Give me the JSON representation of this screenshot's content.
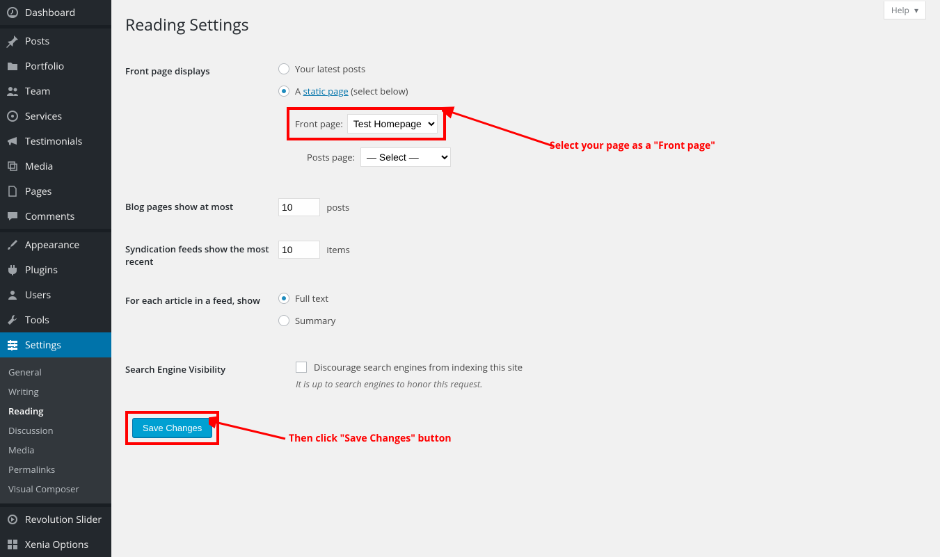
{
  "sidebar": {
    "items": [
      {
        "label": "Dashboard"
      },
      {
        "label": "Posts"
      },
      {
        "label": "Portfolio"
      },
      {
        "label": "Team"
      },
      {
        "label": "Services"
      },
      {
        "label": "Testimonials"
      },
      {
        "label": "Media"
      },
      {
        "label": "Pages"
      },
      {
        "label": "Comments"
      },
      {
        "label": "Appearance"
      },
      {
        "label": "Plugins"
      },
      {
        "label": "Users"
      },
      {
        "label": "Tools"
      },
      {
        "label": "Settings"
      }
    ],
    "submenu": [
      {
        "label": "General"
      },
      {
        "label": "Writing"
      },
      {
        "label": "Reading"
      },
      {
        "label": "Discussion"
      },
      {
        "label": "Media"
      },
      {
        "label": "Permalinks"
      },
      {
        "label": "Visual Composer"
      }
    ],
    "tail": [
      {
        "label": "Revolution Slider"
      },
      {
        "label": "Xenia Options"
      }
    ]
  },
  "help": {
    "label": "Help"
  },
  "page": {
    "title": "Reading Settings"
  },
  "front": {
    "heading": "Front page displays",
    "opt_latest": "Your latest posts",
    "opt_static_prefix": "A ",
    "opt_static_link": "static page",
    "opt_static_suffix": " (select below)",
    "front_label": "Front page:",
    "front_value": "Test Homepage",
    "posts_label": "Posts page:",
    "posts_value": "— Select —"
  },
  "blog": {
    "label": "Blog pages show at most",
    "value": "10",
    "unit": "posts"
  },
  "synd": {
    "label": "Syndication feeds show the most recent",
    "value": "10",
    "unit": "items"
  },
  "article": {
    "label": "For each article in a feed, show",
    "full": "Full text",
    "summary": "Summary"
  },
  "sev": {
    "label": "Search Engine Visibility",
    "checkbox": "Discourage search engines from indexing this site",
    "note": "It is up to search engines to honor this request."
  },
  "save": {
    "label": "Save Changes"
  },
  "annot": {
    "select": "Select your page as a \"Front page\"",
    "save": "Then click \"Save Changes\" button"
  }
}
